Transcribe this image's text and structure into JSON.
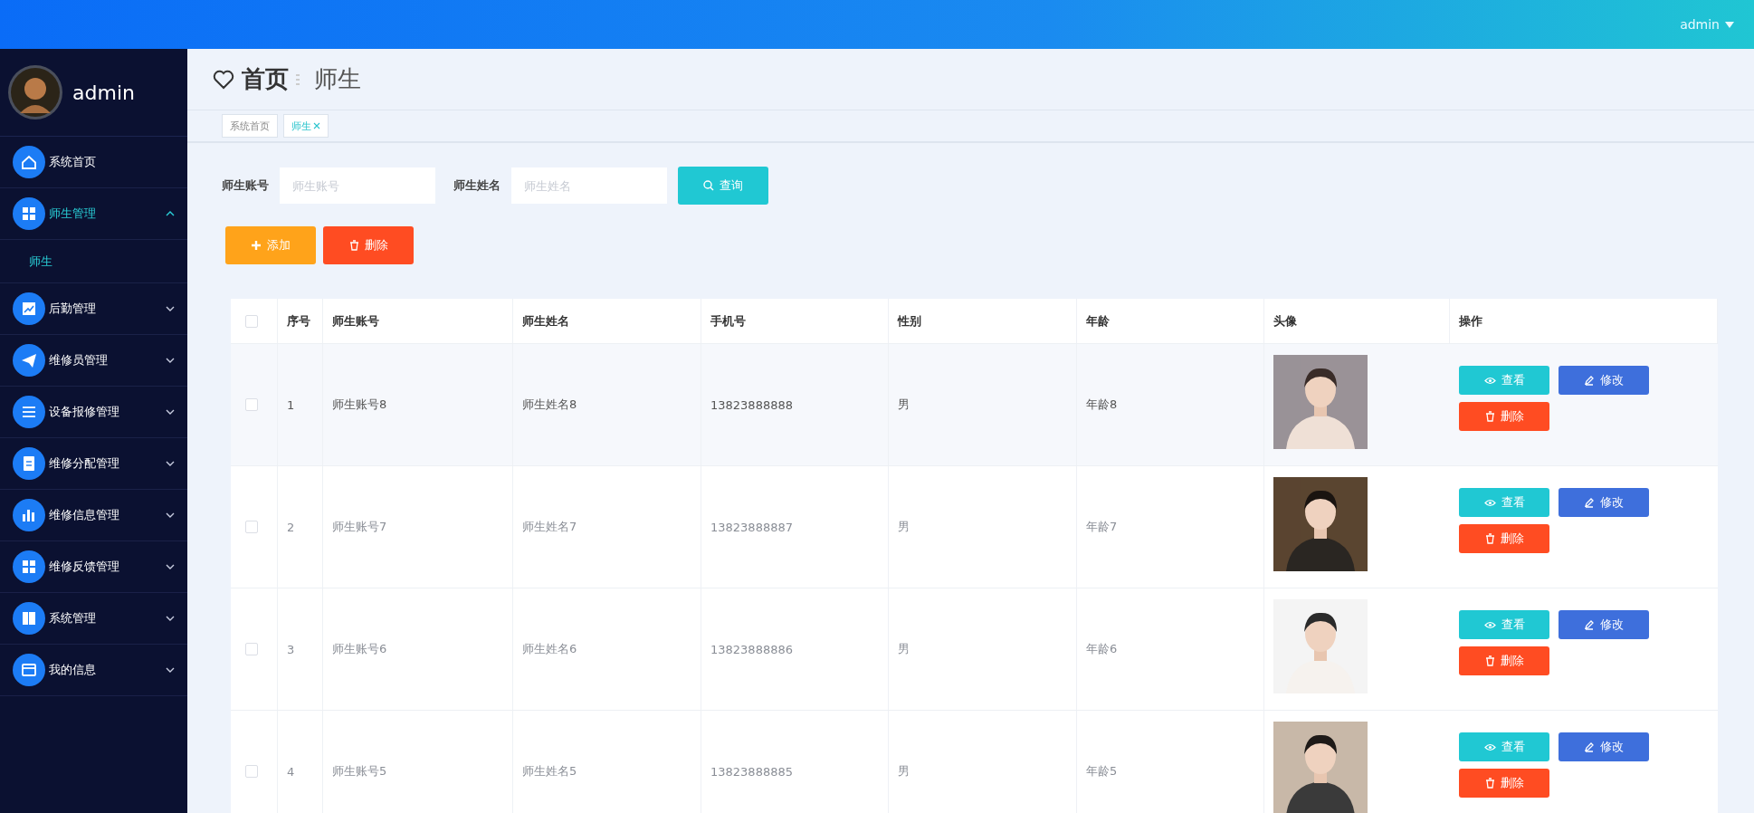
{
  "topbar": {
    "user": "admin"
  },
  "sidebar": {
    "user": "admin",
    "menu": [
      {
        "label": "系统首页",
        "expandable": false,
        "expanded": false
      },
      {
        "label": "师生管理",
        "expandable": true,
        "expanded": true,
        "children": [
          {
            "label": "师生",
            "selected": true
          }
        ]
      },
      {
        "label": "后勤管理",
        "expandable": true,
        "expanded": false
      },
      {
        "label": "维修员管理",
        "expandable": true,
        "expanded": false
      },
      {
        "label": "设备报修管理",
        "expandable": true,
        "expanded": false
      },
      {
        "label": "维修分配管理",
        "expandable": true,
        "expanded": false
      },
      {
        "label": "维修信息管理",
        "expandable": true,
        "expanded": false
      },
      {
        "label": "维修反馈管理",
        "expandable": true,
        "expanded": false
      },
      {
        "label": "系统管理",
        "expandable": true,
        "expanded": false
      },
      {
        "label": "我的信息",
        "expandable": true,
        "expanded": false
      }
    ]
  },
  "breadcrumb": {
    "home": "首页",
    "current": "师生"
  },
  "tabs": [
    {
      "label": "系统首页",
      "selected": false,
      "closable": false
    },
    {
      "label": "师生",
      "selected": true,
      "closable": true
    }
  ],
  "search": {
    "fields": [
      {
        "label": "师生账号",
        "placeholder": "师生账号"
      },
      {
        "label": "师生姓名",
        "placeholder": "师生姓名"
      }
    ],
    "button": "查询"
  },
  "actions": [
    {
      "kind": "add",
      "label": "添加"
    },
    {
      "kind": "delete",
      "label": "删除"
    }
  ],
  "table": {
    "all_checked": false,
    "columns": [
      "序号",
      "师生账号",
      "师生姓名",
      "手机号",
      "性别",
      "年龄",
      "头像",
      "操作"
    ],
    "rows": [
      {
        "hovered": true,
        "checked": false,
        "cells": [
          "1",
          "师生账号8",
          "师生姓名8",
          "13823888888",
          "男",
          "年龄8"
        ],
        "actions": [
          {
            "kind": "view",
            "label": "查看"
          },
          {
            "kind": "edit",
            "label": "修改"
          },
          {
            "kind": "delete",
            "label": "删除"
          }
        ]
      },
      {
        "hovered": false,
        "checked": false,
        "cells": [
          "2",
          "师生账号7",
          "师生姓名7",
          "13823888887",
          "男",
          "年龄7"
        ],
        "actions": [
          {
            "kind": "view",
            "label": "查看"
          },
          {
            "kind": "edit",
            "label": "修改"
          },
          {
            "kind": "delete",
            "label": "删除"
          }
        ]
      },
      {
        "hovered": false,
        "checked": false,
        "cells": [
          "3",
          "师生账号6",
          "师生姓名6",
          "13823888886",
          "男",
          "年龄6"
        ],
        "actions": [
          {
            "kind": "view",
            "label": "查看"
          },
          {
            "kind": "edit",
            "label": "修改"
          },
          {
            "kind": "delete",
            "label": "删除"
          }
        ]
      },
      {
        "hovered": false,
        "checked": false,
        "cells": [
          "4",
          "师生账号5",
          "师生姓名5",
          "13823888885",
          "男",
          "年龄5"
        ],
        "actions": [
          {
            "kind": "view",
            "label": "查看"
          },
          {
            "kind": "edit",
            "label": "修改"
          },
          {
            "kind": "delete",
            "label": "删除"
          }
        ]
      }
    ]
  }
}
